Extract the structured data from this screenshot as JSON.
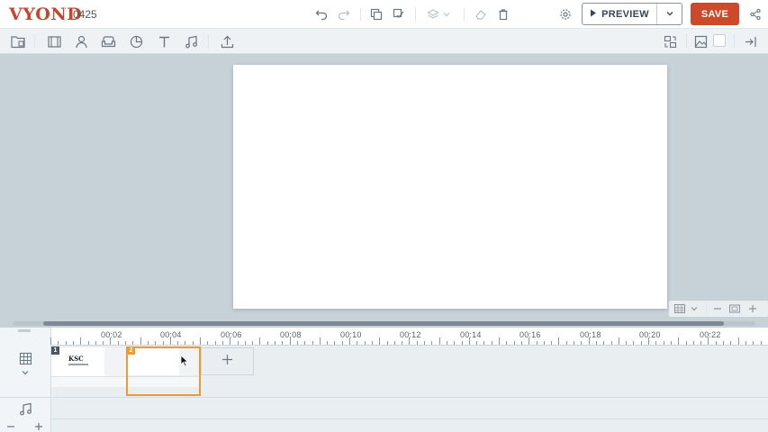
{
  "app": {
    "logo_text": "VYOND",
    "project_name": "0425"
  },
  "header": {
    "preview_label": "PREVIEW",
    "save_label": "SAVE"
  },
  "timeline": {
    "ruler_labels": [
      "00:02",
      "00:04",
      "00:06",
      "00:08",
      "00:10",
      "00:12",
      "00:14",
      "00:16",
      "00:18",
      "00:20",
      "00:22"
    ],
    "scenes": [
      {
        "number": "1",
        "thumb_text": "KSC"
      },
      {
        "number": "2",
        "thumb_text": ""
      }
    ],
    "add_scene_label": "+"
  },
  "colors": {
    "accent": "#cc4a2b",
    "selection": "#e99b34",
    "stage_bg": "#c6d1d8"
  },
  "icons": [
    "undo-icon",
    "redo-icon",
    "copy-icon",
    "paste-icon",
    "layers-icon",
    "eraser-icon",
    "trash-icon",
    "gear-icon",
    "play-icon",
    "chevron-down-icon",
    "share-icon",
    "templates-icon",
    "props-icon",
    "character-icon",
    "sofa-icon",
    "chart-icon",
    "text-icon",
    "music-icon",
    "upload-icon",
    "swap-icon",
    "image-icon",
    "exit-icon",
    "grid-icon",
    "zoom-out-icon",
    "fit-icon",
    "zoom-in-icon",
    "scene-icon",
    "plus-icon",
    "minus-icon",
    "pointer-icon"
  ]
}
